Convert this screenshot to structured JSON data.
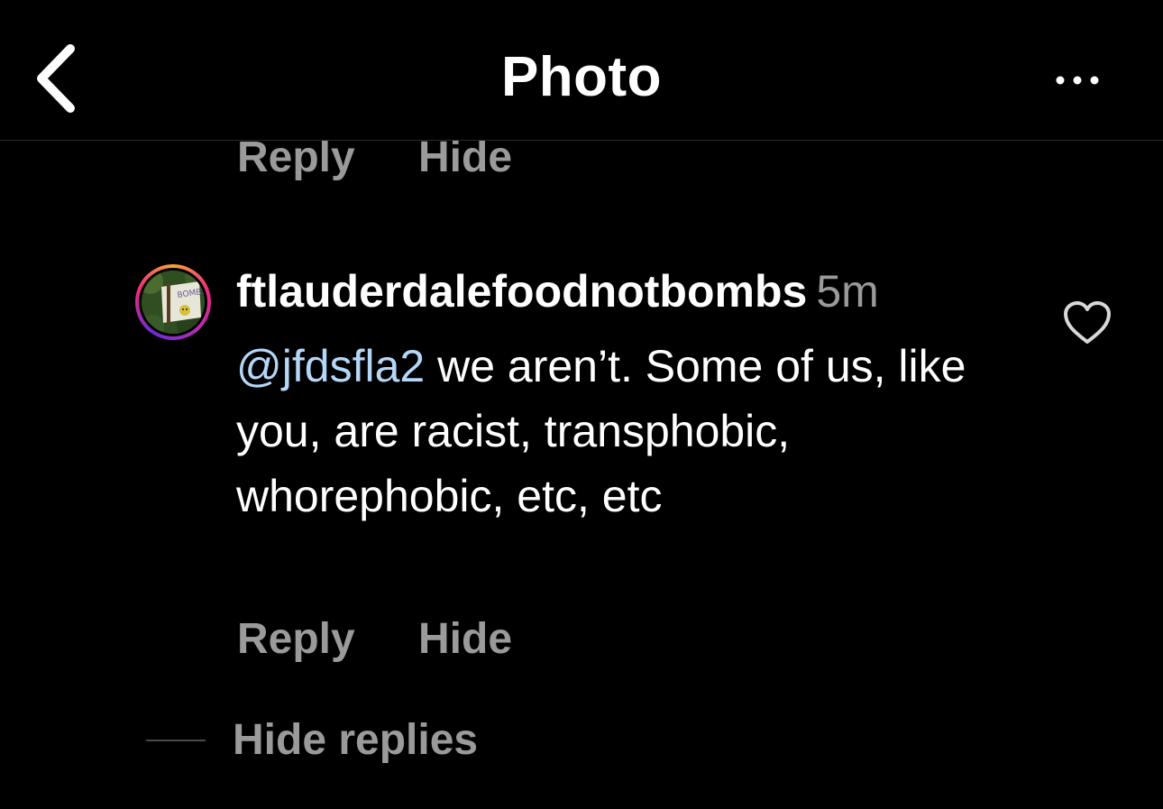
{
  "header": {
    "title": "Photo",
    "back_icon": "chevron-left-icon",
    "more_icon": "more-horizontal-icon"
  },
  "previous_comment_actions": {
    "reply_label": "Reply",
    "hide_label": "Hide"
  },
  "comment": {
    "username": "ftlauderdalefoodnotbombs",
    "timestamp": "5m",
    "mention": "@jfdsfla2",
    "text": " we aren’t. Some of us, like you, are racist, transphobic, whorephobic, etc, etc",
    "avatar_sign_text": "BOMBS",
    "reply_label": "Reply",
    "hide_label": "Hide",
    "like_icon": "heart-outline-icon"
  },
  "thread": {
    "hide_replies_label": "Hide replies"
  },
  "colors": {
    "background": "#000000",
    "text_primary": "#ffffff",
    "text_secondary": "#9a9a9a",
    "mention": "#b4d7f8"
  }
}
